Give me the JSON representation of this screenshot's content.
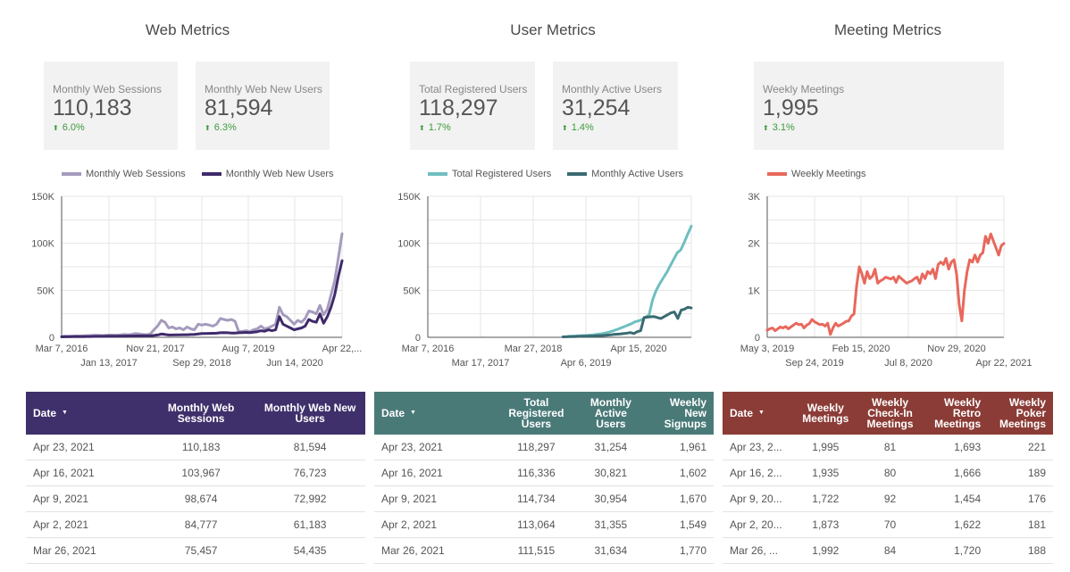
{
  "sections": [
    {
      "title": "Web Metrics"
    },
    {
      "title": "User Metrics"
    },
    {
      "title": "Meeting Metrics"
    }
  ],
  "kpis": [
    {
      "label": "Monthly Web Sessions",
      "value": "110,183",
      "delta": "6.0%",
      "direction": "up"
    },
    {
      "label": "Monthly Web New Users",
      "value": "81,594",
      "delta": "6.3%",
      "direction": "up"
    },
    {
      "label": "Total Registered Users",
      "value": "118,297",
      "delta": "1.7%",
      "direction": "up"
    },
    {
      "label": "Monthly Active Users",
      "value": "31,254",
      "delta": "1.4%",
      "direction": "up"
    },
    {
      "label": "Weekly Meetings",
      "value": "1,995",
      "delta": "3.1%",
      "direction": "up"
    }
  ],
  "icons": {
    "up_arrow": "arrow-up-icon",
    "sort": "caret-down-icon"
  },
  "chart_data": [
    {
      "type": "line",
      "title": "Web Metrics",
      "xlabel": "",
      "ylabel": "",
      "ylim": [
        0,
        150000
      ],
      "yticks": [
        "0",
        "50K",
        "100K",
        "150K"
      ],
      "xticks_row1": [
        "Mar 7, 2016",
        "Nov 21, 2017",
        "Aug 7, 2019",
        "Apr 22,..."
      ],
      "xticks_row2": [
        "Jan 13, 2017",
        "Sep 29, 2018",
        "Jun 14, 2020"
      ],
      "legend_position": "top",
      "grid": true,
      "series": [
        {
          "name": "Monthly Web Sessions",
          "color": "#a59bbd",
          "values": [
            1000,
            1200,
            1100,
            1300,
            1500,
            1400,
            1600,
            1800,
            2000,
            2200,
            2100,
            1900,
            2200,
            2500,
            2400,
            2300,
            2600,
            3000,
            2800,
            3200,
            4000,
            3600,
            3000,
            2800,
            3500,
            8000,
            12000,
            18000,
            16000,
            10000,
            11000,
            9000,
            10000,
            8000,
            11000,
            9000,
            8000,
            14000,
            13000,
            14000,
            13000,
            12000,
            14000,
            20000,
            19000,
            18000,
            19000,
            17000,
            6000,
            6500,
            7000,
            6000,
            8000,
            9000,
            12000,
            9000,
            10000,
            12000,
            14000,
            32000,
            24000,
            22000,
            18000,
            14000,
            18000,
            16000,
            20000,
            28000,
            27000,
            25000,
            34000,
            24000,
            30000,
            45000,
            60000,
            85000,
            110183
          ]
        },
        {
          "name": "Monthly Web New Users",
          "color": "#3f2a6b",
          "values": [
            500,
            600,
            600,
            700,
            700,
            800,
            800,
            900,
            900,
            1000,
            1000,
            1000,
            1100,
            1100,
            1200,
            1200,
            1300,
            1300,
            1400,
            1400,
            1500,
            1500,
            1600,
            1600,
            1700,
            2000,
            2500,
            3500,
            3000,
            2500,
            2500,
            2600,
            2700,
            2800,
            2800,
            2900,
            3000,
            3500,
            4000,
            4000,
            4200,
            4300,
            4400,
            4800,
            5000,
            4800,
            4600,
            4500,
            4800,
            5000,
            5200,
            5000,
            5500,
            6000,
            7000,
            6500,
            8000,
            7000,
            8000,
            22000,
            14000,
            12000,
            10000,
            8000,
            9000,
            10000,
            12000,
            19000,
            17000,
            16000,
            25000,
            15000,
            22000,
            32000,
            45000,
            65000,
            81594
          ]
        }
      ]
    },
    {
      "type": "line",
      "title": "User Metrics",
      "xlabel": "",
      "ylabel": "",
      "ylim": [
        0,
        150000
      ],
      "yticks": [
        "0",
        "50K",
        "100K",
        "150K"
      ],
      "xticks_row1": [
        "Mar 7, 2016",
        "Mar 27, 2018",
        "Apr 15, 2020"
      ],
      "xticks_row2": [
        "Mar 17, 2017",
        "Apr 6, 2019"
      ],
      "legend_position": "top",
      "grid": true,
      "series": [
        {
          "name": "Total Registered Users",
          "color": "#6fbfbf",
          "values": [
            null,
            null,
            null,
            null,
            null,
            null,
            null,
            null,
            null,
            null,
            null,
            null,
            null,
            null,
            null,
            null,
            null,
            null,
            null,
            null,
            null,
            null,
            null,
            null,
            null,
            null,
            null,
            null,
            null,
            null,
            null,
            null,
            null,
            null,
            null,
            null,
            null,
            null,
            null,
            null,
            1000,
            1200,
            1400,
            1600,
            1800,
            2000,
            2300,
            2600,
            3000,
            3500,
            4200,
            5000,
            6000,
            7200,
            8500,
            10000,
            11500,
            13000,
            14500,
            16500,
            17500,
            19000,
            21500,
            24000,
            40000,
            50000,
            57000,
            63000,
            69000,
            76000,
            83000,
            90000,
            93000,
            101000,
            110000,
            118297
          ]
        },
        {
          "name": "Monthly Active Users",
          "color": "#3a6a72",
          "values": [
            null,
            null,
            null,
            null,
            null,
            null,
            null,
            null,
            null,
            null,
            null,
            null,
            null,
            null,
            null,
            null,
            null,
            null,
            null,
            null,
            null,
            null,
            null,
            null,
            null,
            null,
            null,
            null,
            null,
            null,
            null,
            null,
            null,
            null,
            null,
            null,
            null,
            null,
            null,
            null,
            500,
            600,
            700,
            800,
            900,
            1000,
            1100,
            1200,
            1300,
            1400,
            1600,
            1800,
            2000,
            2300,
            2600,
            3000,
            3300,
            3600,
            4000,
            4500,
            5000,
            4000,
            6000,
            7000,
            21000,
            21500,
            21800,
            22000,
            21000,
            20000,
            22000,
            24000,
            26000,
            27000,
            20000,
            29000,
            30000,
            32000,
            31254
          ]
        }
      ]
    },
    {
      "type": "line",
      "title": "Meeting Metrics",
      "xlabel": "",
      "ylabel": "",
      "ylim": [
        0,
        3000
      ],
      "yticks": [
        "0",
        "1K",
        "2K",
        "3K"
      ],
      "xticks_row1": [
        "May 3, 2019",
        "Feb 15, 2020",
        "Nov 29, 2020"
      ],
      "xticks_row2": [
        "Sep 24, 2019",
        "Jul 8, 2020",
        "Apr 22, 2021"
      ],
      "legend_position": "top-left",
      "grid": true,
      "series": [
        {
          "name": "Weekly Meetings",
          "color": "#e8685c",
          "values": [
            150,
            180,
            200,
            140,
            180,
            220,
            200,
            230,
            180,
            220,
            260,
            300,
            270,
            280,
            200,
            260,
            290,
            380,
            330,
            300,
            270,
            280,
            240,
            300,
            60,
            200,
            300,
            240,
            270,
            300,
            340,
            350,
            450,
            500,
            1100,
            1500,
            1350,
            1150,
            1400,
            1250,
            1300,
            1450,
            1150,
            1200,
            1230,
            1280,
            1260,
            1240,
            1280,
            1170,
            1300,
            1250,
            1200,
            1150,
            1180,
            1200,
            1250,
            1280,
            1150,
            1350,
            1250,
            1400,
            1350,
            1450,
            1250,
            1550,
            1600,
            1550,
            1680,
            1450,
            1600,
            1650,
            1350,
            700,
            350,
            1000,
            1400,
            1650,
            1600,
            1750,
            1600,
            1750,
            1800,
            2150,
            2000,
            2200,
            2050,
            1900,
            1750,
            1950,
            1995
          ]
        }
      ]
    }
  ],
  "tables": [
    {
      "header_color": "#3f306b",
      "columns": [
        "Date",
        "Monthly Web Sessions",
        "Monthly Web New Users"
      ],
      "rows": [
        [
          "Apr 23, 2021",
          "110,183",
          "81,594"
        ],
        [
          "Apr 16, 2021",
          "103,967",
          "76,723"
        ],
        [
          "Apr 9, 2021",
          "98,674",
          "72,992"
        ],
        [
          "Apr 2, 2021",
          "84,777",
          "61,183"
        ],
        [
          "Mar 26, 2021",
          "75,457",
          "54,435"
        ]
      ]
    },
    {
      "header_color": "#4a7a78",
      "columns": [
        "Date",
        "Total Registered Users",
        "Monthly Active Users",
        "Weekly New Signups"
      ],
      "rows": [
        [
          "Apr 23, 2021",
          "118,297",
          "31,254",
          "1,961"
        ],
        [
          "Apr 16, 2021",
          "116,336",
          "30,821",
          "1,602"
        ],
        [
          "Apr 9, 2021",
          "114,734",
          "30,954",
          "1,670"
        ],
        [
          "Apr 2, 2021",
          "113,064",
          "31,355",
          "1,549"
        ],
        [
          "Mar 26, 2021",
          "111,515",
          "31,634",
          "1,770"
        ]
      ]
    },
    {
      "header_color": "#8b3c36",
      "columns": [
        "Date",
        "Weekly Meetings",
        "Weekly Check-In Meetings",
        "Weekly Retro Meetings",
        "Weekly Poker Meetings"
      ],
      "rows": [
        [
          "Apr 23, 2...",
          "1,995",
          "81",
          "1,693",
          "221"
        ],
        [
          "Apr 16, 2...",
          "1,935",
          "80",
          "1,666",
          "189"
        ],
        [
          "Apr 9, 20...",
          "1,722",
          "92",
          "1,454",
          "176"
        ],
        [
          "Apr 2, 20...",
          "1,873",
          "70",
          "1,622",
          "181"
        ],
        [
          "Mar 26, ...",
          "1,992",
          "84",
          "1,720",
          "188"
        ]
      ]
    }
  ]
}
